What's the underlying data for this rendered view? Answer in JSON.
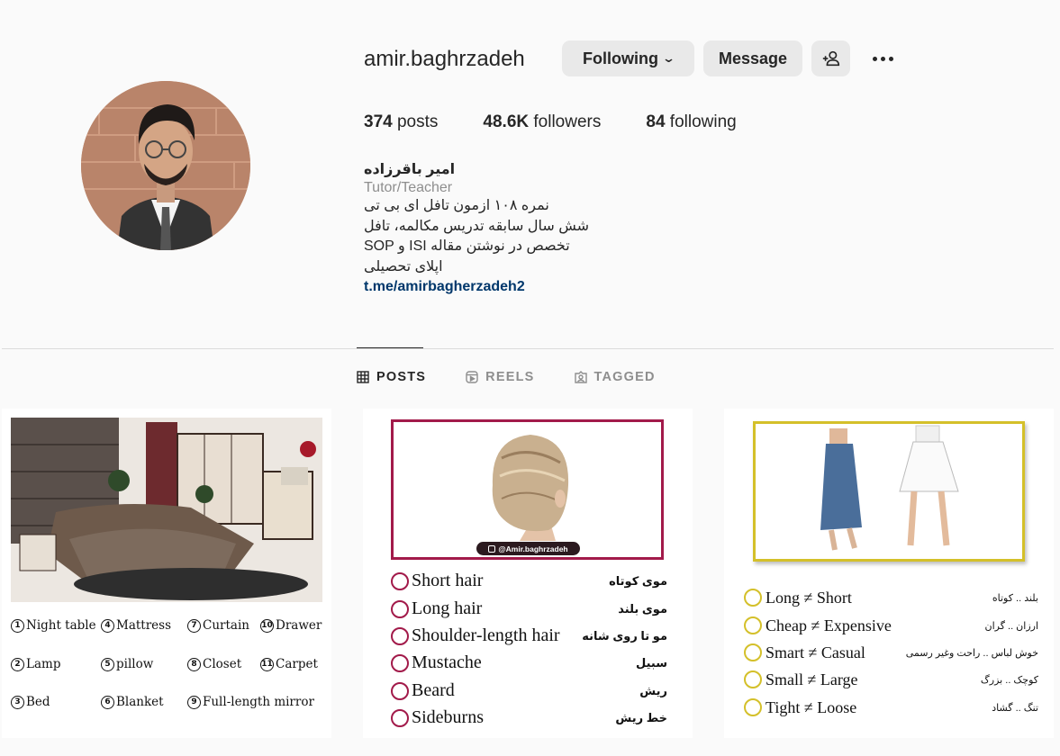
{
  "profile": {
    "username": "amir.baghrzadeh",
    "following_button": "Following",
    "message_button": "Message",
    "stats": {
      "posts_count": "374",
      "posts_label": "posts",
      "followers_count": "48.6K",
      "followers_label": "followers",
      "following_count": "84",
      "following_label": "following"
    },
    "bio": {
      "name": "امیر باقرزاده",
      "category": "Tutor/Teacher",
      "lines": [
        "نمره ۱۰۸ ازمون تافل ای بی تی",
        "شش سال سابقه تدریس مکالمه، تافل",
        "SOP و ISI تخصص در نوشتن مقاله",
        "اپلای تحصیلی"
      ],
      "link": "t.me/amirbagherzadeh2"
    }
  },
  "tabs": [
    {
      "label": "POSTS",
      "icon": "grid-icon",
      "active": true
    },
    {
      "label": "REELS",
      "icon": "reels-icon",
      "active": false
    },
    {
      "label": "TAGGED",
      "icon": "tagged-icon",
      "active": false
    }
  ],
  "posts": {
    "bedroom": {
      "labels": [
        {
          "n": "1",
          "text": "Night table"
        },
        {
          "n": "4",
          "text": "Mattress"
        },
        {
          "n": "7",
          "text": "Curtain"
        },
        {
          "n": "10",
          "text": "Drawer"
        },
        {
          "n": "2",
          "text": "Lamp"
        },
        {
          "n": "5",
          "text": "pillow"
        },
        {
          "n": "8",
          "text": "Closet"
        },
        {
          "n": "11",
          "text": "Carpet"
        },
        {
          "n": "3",
          "text": "Bed"
        },
        {
          "n": "6",
          "text": "Blanket"
        },
        {
          "n": "9",
          "text": "Full-length mirror"
        }
      ]
    },
    "hair": {
      "handle": "@Amir.baghrzadeh",
      "rows": [
        {
          "en": "Short hair",
          "fa": "موی کوتاه"
        },
        {
          "en": "Long hair",
          "fa": "موی بلند"
        },
        {
          "en": "Shoulder-length hair",
          "fa": "مو تا روی شانه"
        },
        {
          "en": "Mustache",
          "fa": "سبیل"
        },
        {
          "en": "Beard",
          "fa": "ریش"
        },
        {
          "en": "Sideburns",
          "fa": "خط ریش"
        }
      ]
    },
    "opposites": {
      "rows": [
        {
          "en": "Long ≠ Short",
          "fa": "بلند .. کوتاه"
        },
        {
          "en": "Cheap ≠ Expensive",
          "fa": "ارزان .. گران"
        },
        {
          "en": "Smart ≠ Casual",
          "fa": "خوش لباس .. راحت وغیر رسمی"
        },
        {
          "en": "Small ≠ Large",
          "fa": "کوچک .. بزرگ"
        },
        {
          "en": "Tight ≠ Loose",
          "fa": "تنگ .. گشاد"
        }
      ]
    }
  },
  "colors": {
    "hair_accent": "#a21a4a",
    "opposites_accent": "#d4c02a",
    "link": "#00376b"
  }
}
